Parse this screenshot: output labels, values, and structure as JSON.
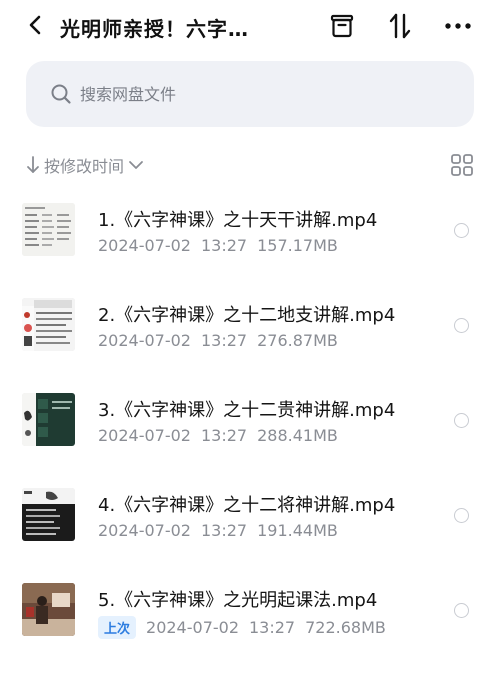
{
  "header": {
    "title": "光明师亲授！六字…",
    "back_icon": "back-chevron-icon",
    "archive_icon": "archive-icon",
    "sort_icon": "sort-arrows-icon",
    "more_icon": "more-dots-icon"
  },
  "search": {
    "placeholder": "搜索网盘文件",
    "icon": "search-icon"
  },
  "sort": {
    "label": "按修改时间",
    "arrow_icon": "arrow-down-icon",
    "chevron_icon": "chevron-down-icon",
    "view_toggle_icon": "grid-view-icon"
  },
  "files": [
    {
      "name": "1.《六字神课》之十天干讲解.mp4",
      "date": "2024-07-02",
      "time": "13:27",
      "size": "157.17MB",
      "badge": ""
    },
    {
      "name": "2.《六字神课》之十二地支讲解.mp4",
      "date": "2024-07-02",
      "time": "13:27",
      "size": "276.87MB",
      "badge": ""
    },
    {
      "name": "3.《六字神课》之十二贵神讲解.mp4",
      "date": "2024-07-02",
      "time": "13:27",
      "size": "288.41MB",
      "badge": ""
    },
    {
      "name": "4.《六字神课》之十二将神讲解.mp4",
      "date": "2024-07-02",
      "time": "13:27",
      "size": "191.44MB",
      "badge": ""
    },
    {
      "name": "5.《六字神课》之光明起课法.mp4",
      "date": "2024-07-02",
      "time": "13:27",
      "size": "722.68MB",
      "badge": "上次"
    }
  ],
  "colors": {
    "background": "#ffffff",
    "search_bg": "#eff1f6",
    "meta_text": "#8a8d94",
    "badge_bg": "#e5f1fe",
    "badge_text": "#2d7de0"
  }
}
